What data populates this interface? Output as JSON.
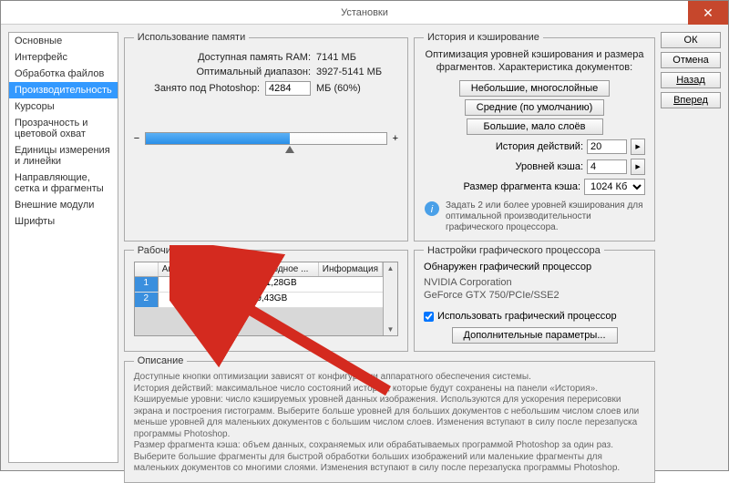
{
  "window": {
    "title": "Установки"
  },
  "sidebar": {
    "items": [
      {
        "label": "Основные"
      },
      {
        "label": "Интерфейс"
      },
      {
        "label": "Обработка файлов"
      },
      {
        "label": "Производительность"
      },
      {
        "label": "Курсоры"
      },
      {
        "label": "Прозрачность и цветовой охват"
      },
      {
        "label": "Единицы измерения и линейки"
      },
      {
        "label": "Направляющие, сетка и фрагменты"
      },
      {
        "label": "Внешние модули"
      },
      {
        "label": "Шрифты"
      }
    ],
    "activeIndex": 3
  },
  "buttons": {
    "ok": "ОК",
    "cancel": "Отмена",
    "back": "Назад",
    "forward": "Вперед"
  },
  "memory": {
    "legend": "Использование памяти",
    "available_label": "Доступная память RAM:",
    "available_value": "7141 МБ",
    "range_label": "Оптимальный диапазон:",
    "range_value": "3927-5141 МБ",
    "used_label": "Занято под Photoshop:",
    "used_value": "4284",
    "used_suffix": "МБ (60%)",
    "minus": "−",
    "plus": "+"
  },
  "history": {
    "legend": "История и кэширование",
    "line1": "Оптимизация уровней кэширования и размера",
    "line2": "фрагментов. Характеристика документов:",
    "btn_small": "Небольшие, многослойные",
    "btn_default": "Средние (по умолчанию)",
    "btn_big": "Большие, мало слоёв",
    "history_label": "История действий:",
    "history_value": "20",
    "cache_label": "Уровней кэша:",
    "cache_value": "4",
    "tile_label": "Размер фрагмента кэша:",
    "tile_value": "1024 Кб",
    "info": "Задать 2 или более уровней кэширования для оптимальной производительности графического процессора."
  },
  "disks": {
    "legend": "Рабочие диски",
    "cols": {
      "c1": "",
      "c2": "Актив...",
      "c3": "Диск",
      "c4": "Свободное ...",
      "c5": "Информация"
    },
    "rows": [
      {
        "n": "1",
        "active": true,
        "disk": "D:\\",
        "free": "1131,28GB",
        "info": ""
      },
      {
        "n": "2",
        "active": false,
        "disk": "C:\\",
        "free": "19,43GB",
        "info": ""
      }
    ]
  },
  "gpu": {
    "legend": "Настройки графического процессора",
    "detected_label": "Обнаружен графический процессор",
    "vendor": "NVIDIA Corporation",
    "model": "GeForce GTX 750/PCIe/SSE2",
    "use_label": "Использовать графический процессор",
    "extra_btn": "Дополнительные параметры..."
  },
  "desc": {
    "legend": "Описание",
    "text": "Доступные кнопки оптимизации зависят от конфигурации аппаратного обеспечения системы.\nИстория действий: максимальное число состояний истории, которые будут сохранены на панели «История».\nКэшируемые уровни: число кэшируемых уровней данных изображения. Используются для ускорения перерисовки экрана и построения гистограмм. Выберите больше уровней для больших документов с небольшим числом слоев или меньше уровней для маленьких документов с большим числом слоев. Изменения вступают в силу после перезапуска программы Photoshop.\nРазмер фрагмента кэша: объем данных, сохраняемых или обрабатываемых программой Photoshop за один раз. Выберите большие фрагменты для быстрой обработки больших изображений или маленькие фрагменты для маленьких документов со многими слоями. Изменения вступают в силу после перезапуска программы Photoshop."
  }
}
